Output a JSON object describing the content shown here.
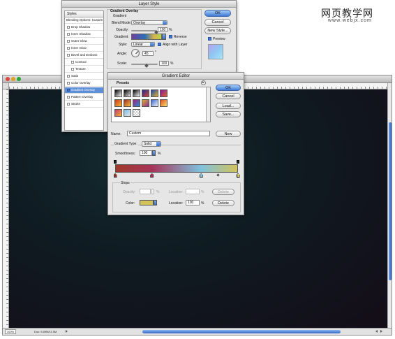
{
  "watermark": {
    "title": "网页教学网",
    "url": "www.webjx.com"
  },
  "document": {
    "zoom": "100%",
    "doc_info": "Doc: 6.59M/11.5M",
    "traffic_colors": [
      "#e0443e",
      "#dea123",
      "#27a838"
    ],
    "canvas_colors": [
      "#152c31",
      "#0f1b22",
      "#140d18"
    ]
  },
  "layer_style": {
    "title": "Layer Style",
    "styles_header": "Styles",
    "items": [
      {
        "label": "Blending Options: Custom",
        "checked": false,
        "sub": false,
        "active": false
      },
      {
        "label": "Drop Shadow",
        "checked": false,
        "sub": false,
        "active": false
      },
      {
        "label": "Inner Shadow",
        "checked": false,
        "sub": false,
        "active": false
      },
      {
        "label": "Outer Glow",
        "checked": false,
        "sub": false,
        "active": false
      },
      {
        "label": "Inner Glow",
        "checked": false,
        "sub": false,
        "active": false
      },
      {
        "label": "Bevel and Emboss",
        "checked": false,
        "sub": false,
        "active": false
      },
      {
        "label": "Contour",
        "checked": false,
        "sub": true,
        "active": false
      },
      {
        "label": "Texture",
        "checked": false,
        "sub": true,
        "active": false
      },
      {
        "label": "Satin",
        "checked": false,
        "sub": false,
        "active": false
      },
      {
        "label": "Color Overlay",
        "checked": false,
        "sub": false,
        "active": false
      },
      {
        "label": "Gradient Overlay",
        "checked": true,
        "sub": false,
        "active": true
      },
      {
        "label": "Pattern Overlay",
        "checked": false,
        "sub": false,
        "active": false
      },
      {
        "label": "Stroke",
        "checked": false,
        "sub": false,
        "active": false
      }
    ],
    "section_title": "Gradient Overlay",
    "group_title": "Gradient",
    "blend_mode_label": "Blend Mode:",
    "blend_mode_value": "Overlay",
    "opacity_label": "Opacity:",
    "opacity_value": "100",
    "opacity_unit": "%",
    "gradient_label": "Gradient:",
    "reverse_label": "Reverse",
    "reverse_checked": true,
    "style_label": "Style:",
    "style_value": "Linear",
    "align_label": "Align with Layer",
    "align_checked": true,
    "angle_label": "Angle:",
    "angle_value": "45",
    "angle_unit": "°",
    "scale_label": "Scale:",
    "scale_value": "100",
    "scale_unit": "%",
    "ok": "OK",
    "cancel": "Cancel",
    "new_style": "New Style...",
    "preview_label": "Preview",
    "preview_checked": true
  },
  "gradient_editor": {
    "title": "Gradient Editor",
    "presets_label": "Presets",
    "ok": "OK",
    "cancel": "Cancel",
    "load": "Load...",
    "save": "Save...",
    "name_label": "Name:",
    "name_value": "Custom",
    "new_button": "New",
    "type_label": "Gradient Type:",
    "type_value": "Solid",
    "smoothness_label": "Smoothness:",
    "smoothness_value": "100",
    "smoothness_unit": "%",
    "stops_title": "Stops",
    "opacity_label": "Opacity:",
    "opacity_unit": "%",
    "location_label": "Location:",
    "location_unit": "%",
    "delete_label": "Delete",
    "color_label": "Color:",
    "color_value": "#d2c35a",
    "location_value": "100",
    "presets": [
      [
        "#000000",
        "#ffffff"
      ],
      [
        "#000000",
        "#00000000"
      ],
      [
        "#000000",
        "#ffffff"
      ],
      [
        "#1d2f8a",
        "#d8453a"
      ],
      [
        "#1846b0",
        "#e2b12c"
      ],
      [
        "#7a1fa0",
        "#e4612b"
      ],
      [
        "#c83a1a",
        "#f3b73a"
      ],
      [
        "#9f2b2b",
        "#f6c43a"
      ],
      [
        "#a51e7a",
        "#2b8fd6"
      ],
      [
        "#d8b22b",
        "#8e2a9a"
      ],
      [
        "#3a6bd6",
        "#f2f2f2"
      ],
      [
        "#e04c2a",
        "#f7e060"
      ],
      [
        "#c93a6e",
        "#f0b23a"
      ],
      [
        "#7abde8",
        "#e5e5e5"
      ],
      [
        "#eeeeee",
        "#cccccc"
      ]
    ],
    "stops": [
      {
        "position": 0,
        "color": "#a03a2a"
      },
      {
        "position": 30,
        "color": "#a7345a"
      },
      {
        "position": 70,
        "color": "#7fc1df"
      },
      {
        "position": 100,
        "color": "#d2c35a"
      }
    ],
    "opacity_stops": [
      0,
      100
    ]
  }
}
